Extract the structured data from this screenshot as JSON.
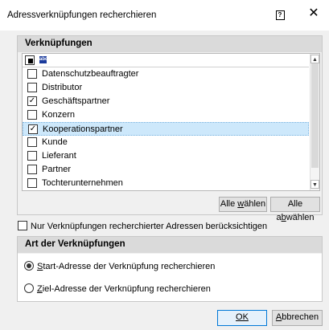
{
  "window": {
    "title": "Adressverknüpfungen recherchieren",
    "help_label": "?",
    "close_label": "✕"
  },
  "links_group": {
    "title": "Verknüpfungen",
    "header_icon_label": "abc",
    "items": [
      {
        "label": "Datenschutzbeauftragter",
        "checked": false
      },
      {
        "label": "Distributor",
        "checked": false
      },
      {
        "label": "Geschäftspartner",
        "checked": true
      },
      {
        "label": "Konzern",
        "checked": false
      },
      {
        "label": "Kooperationspartner",
        "checked": true,
        "selected": true
      },
      {
        "label": "Kunde",
        "checked": false
      },
      {
        "label": "Lieferant",
        "checked": false
      },
      {
        "label": "Partner",
        "checked": false
      },
      {
        "label": "Tochterunternehmen",
        "checked": false
      }
    ],
    "select_all_label_pre": "Alle ",
    "select_all_label_u": "w",
    "select_all_label_post": "ählen",
    "deselect_all_label_pre": "Alle a",
    "deselect_all_label_u": "b",
    "deselect_all_label_post": "wählen"
  },
  "filter": {
    "label": "Nur Verknüpfungen recherchierter Adressen berücksichtigen",
    "checked": false
  },
  "link_type_group": {
    "title": "Art der Verknüpfungen",
    "option_start_u": "S",
    "option_start_rest": "tart-Adresse der Verknüpfung recherchieren",
    "option_target_u": "Z",
    "option_target_rest": "iel-Adresse der Verknüpfung recherchieren",
    "selected": "start"
  },
  "footer": {
    "ok_label": "OK",
    "cancel_label_u": "A",
    "cancel_label_rest": "bbrechen"
  }
}
